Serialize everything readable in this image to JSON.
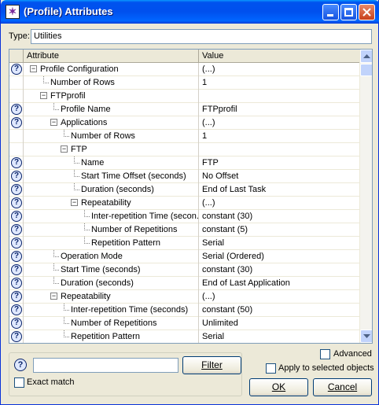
{
  "window": {
    "title": "(Profile) Attributes"
  },
  "type": {
    "label": "Type:",
    "value": "Utilities"
  },
  "grid": {
    "headers": {
      "attribute": "Attribute",
      "value": "Value"
    },
    "rows": [
      {
        "attribute": "Profile Configuration",
        "value": "(...)",
        "level": 0,
        "help": true,
        "toggle": "minus"
      },
      {
        "attribute": "Number of Rows",
        "value": "1",
        "level": 1,
        "help": false,
        "toggle": "none"
      },
      {
        "attribute": "FTPprofil",
        "value": "",
        "level": 1,
        "help": false,
        "toggle": "minus"
      },
      {
        "attribute": "Profile Name",
        "value": "FTPprofil",
        "level": 2,
        "help": true,
        "toggle": "none"
      },
      {
        "attribute": "Applications",
        "value": "(...)",
        "level": 2,
        "help": true,
        "toggle": "minus"
      },
      {
        "attribute": "Number of Rows",
        "value": "1",
        "level": 3,
        "help": false,
        "toggle": "none"
      },
      {
        "attribute": "FTP",
        "value": "",
        "level": 3,
        "help": false,
        "toggle": "minus"
      },
      {
        "attribute": "Name",
        "value": "FTP",
        "level": 4,
        "help": true,
        "toggle": "none"
      },
      {
        "attribute": "Start Time Offset (seconds)",
        "value": "No Offset",
        "level": 4,
        "help": true,
        "toggle": "none"
      },
      {
        "attribute": "Duration (seconds)",
        "value": "End of Last Task",
        "level": 4,
        "help": true,
        "toggle": "none"
      },
      {
        "attribute": "Repeatability",
        "value": "(...)",
        "level": 4,
        "help": true,
        "toggle": "minus"
      },
      {
        "attribute": "Inter-repetition Time (secon...",
        "value": "constant (30)",
        "level": 5,
        "help": true,
        "toggle": "none"
      },
      {
        "attribute": "Number of Repetitions",
        "value": "constant (5)",
        "level": 5,
        "help": true,
        "toggle": "none"
      },
      {
        "attribute": "Repetition Pattern",
        "value": "Serial",
        "level": 5,
        "help": true,
        "toggle": "none"
      },
      {
        "attribute": "Operation Mode",
        "value": "Serial (Ordered)",
        "level": 2,
        "help": true,
        "toggle": "none"
      },
      {
        "attribute": "Start Time (seconds)",
        "value": "constant (30)",
        "level": 2,
        "help": true,
        "toggle": "none"
      },
      {
        "attribute": "Duration (seconds)",
        "value": "End of Last Application",
        "level": 2,
        "help": true,
        "toggle": "none"
      },
      {
        "attribute": "Repeatability",
        "value": "(...)",
        "level": 2,
        "help": true,
        "toggle": "minus"
      },
      {
        "attribute": "Inter-repetition Time (seconds)",
        "value": "constant (50)",
        "level": 3,
        "help": true,
        "toggle": "none"
      },
      {
        "attribute": "Number of Repetitions",
        "value": "Unlimited",
        "level": 3,
        "help": true,
        "toggle": "none"
      },
      {
        "attribute": "Repetition Pattern",
        "value": "Serial",
        "level": 3,
        "help": true,
        "toggle": "none"
      }
    ]
  },
  "filter": {
    "value": "",
    "button_label": "Filter",
    "exact_match_label": "Exact match"
  },
  "options": {
    "advanced_label": "Advanced",
    "apply_selected_label": "Apply to selected objects"
  },
  "buttons": {
    "ok_label": "OK",
    "cancel_label": "Cancel"
  },
  "icons": {
    "help": "help-icon",
    "app": "app-icon"
  }
}
